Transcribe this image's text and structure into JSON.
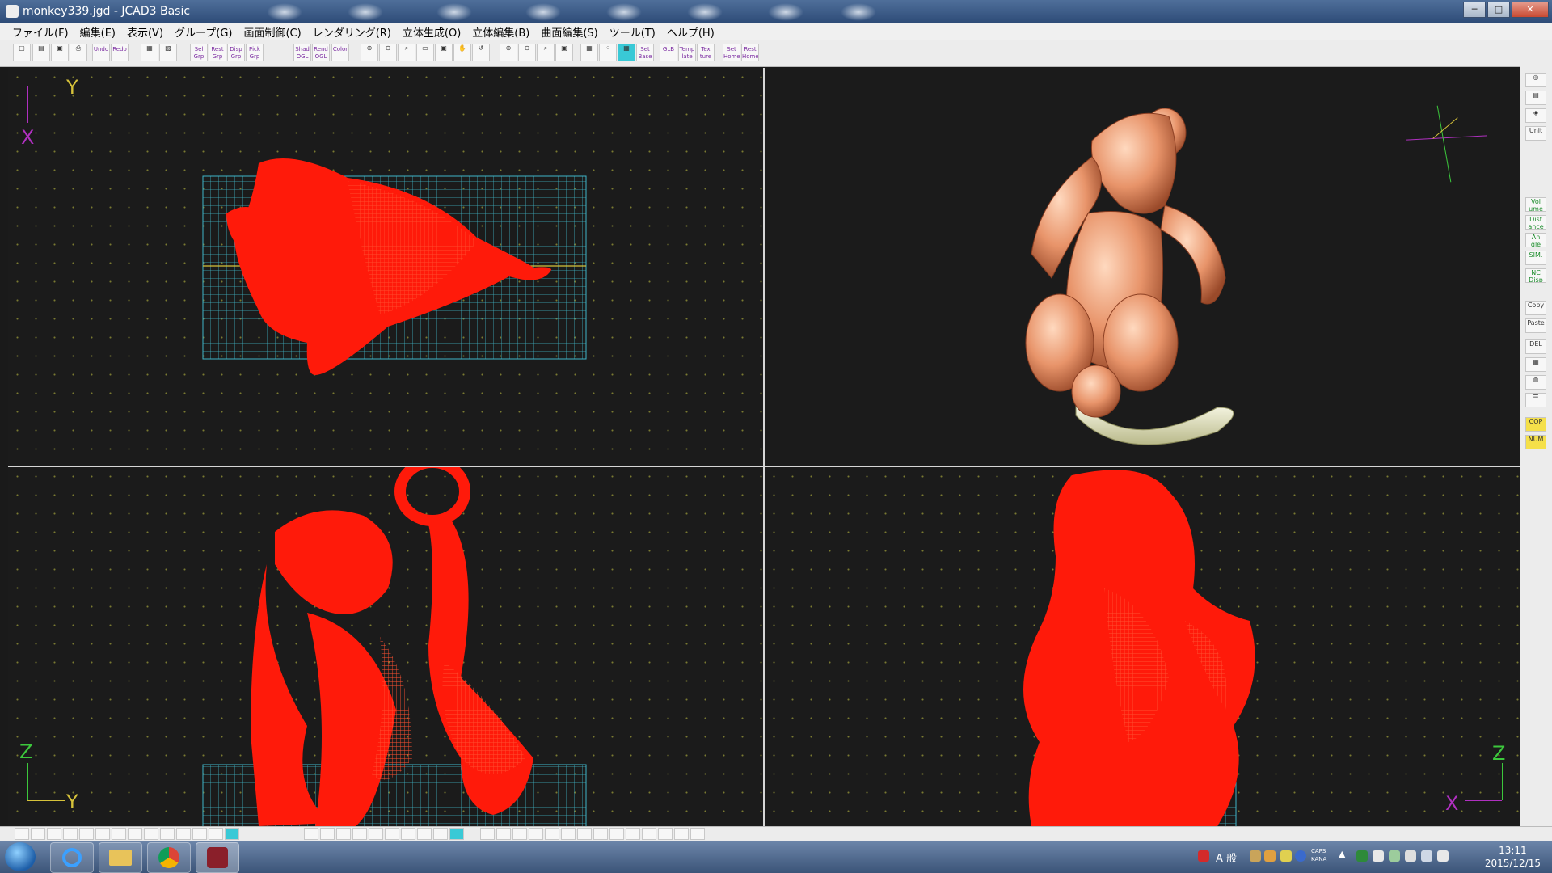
{
  "window": {
    "title": "monkey339.jgd - JCAD3 Basic",
    "min": "─",
    "max": "□",
    "close": "✕"
  },
  "menu": [
    "ファイル(F)",
    "編集(E)",
    "表示(V)",
    "グループ(G)",
    "画面制御(C)",
    "レンダリング(R)",
    "立体生成(O)",
    "立体編集(B)",
    "曲面編集(S)",
    "ツール(T)",
    "ヘルプ(H)"
  ],
  "toolbar": [
    {
      "label": "Undo",
      "icon": "undo-icon"
    },
    {
      "label": "Redo",
      "icon": "redo-icon"
    },
    {
      "label": "Sel Grp",
      "icon": "select-group-icon"
    },
    {
      "label": "Rest Grp",
      "icon": "reset-group-icon"
    },
    {
      "label": "Disp Grp",
      "icon": "display-group-icon"
    },
    {
      "label": "Pick Grp",
      "icon": "pick-group-icon"
    },
    {
      "label": "Shad OGL",
      "icon": "shade-icon"
    },
    {
      "label": "Rend OGL",
      "icon": "render-icon"
    },
    {
      "label": "Color",
      "icon": "color-icon"
    },
    {
      "label": "Set Base",
      "icon": "set-base-icon"
    },
    {
      "label": "GLB",
      "icon": "glb-icon"
    },
    {
      "label": "Temp late",
      "icon": "template-icon"
    },
    {
      "label": "Tex ture",
      "icon": "texture-icon"
    },
    {
      "label": "Set Home",
      "icon": "set-home-icon"
    },
    {
      "label": "Rest Home",
      "icon": "rest-home-icon"
    }
  ],
  "rightbar": [
    {
      "label": "Unit",
      "style": "plain"
    },
    {
      "label": "Vol ume",
      "style": "green"
    },
    {
      "label": "Dist ance",
      "style": "green"
    },
    {
      "label": "An gle",
      "style": "green"
    },
    {
      "label": "SIM.",
      "style": "green"
    },
    {
      "label": "NC Disp",
      "style": "green"
    },
    {
      "label": "Copy",
      "style": "plain"
    },
    {
      "label": "Paste",
      "style": "plain"
    },
    {
      "label": "DEL",
      "style": "plain"
    },
    {
      "label": "COP",
      "style": "yellow"
    },
    {
      "label": "NUM",
      "style": "yellow"
    }
  ],
  "viewports": {
    "top_left": {
      "axis_h": "Y",
      "axis_v": "X"
    },
    "top_right": {},
    "bottom_left": {
      "axis_h": "Y",
      "axis_v": "Z"
    },
    "bottom_right": {
      "axis_h": "X",
      "axis_v": "Z"
    }
  },
  "tray": {
    "ime": "A 般",
    "caps": "CAPS",
    "kana": "KANA",
    "time": "13:11",
    "date": "2015/12/15"
  },
  "colors": {
    "wire": "#ff1a0a",
    "grid": "#3fb6c8",
    "model": "#e8946a",
    "banana": "#f0f0c8"
  }
}
